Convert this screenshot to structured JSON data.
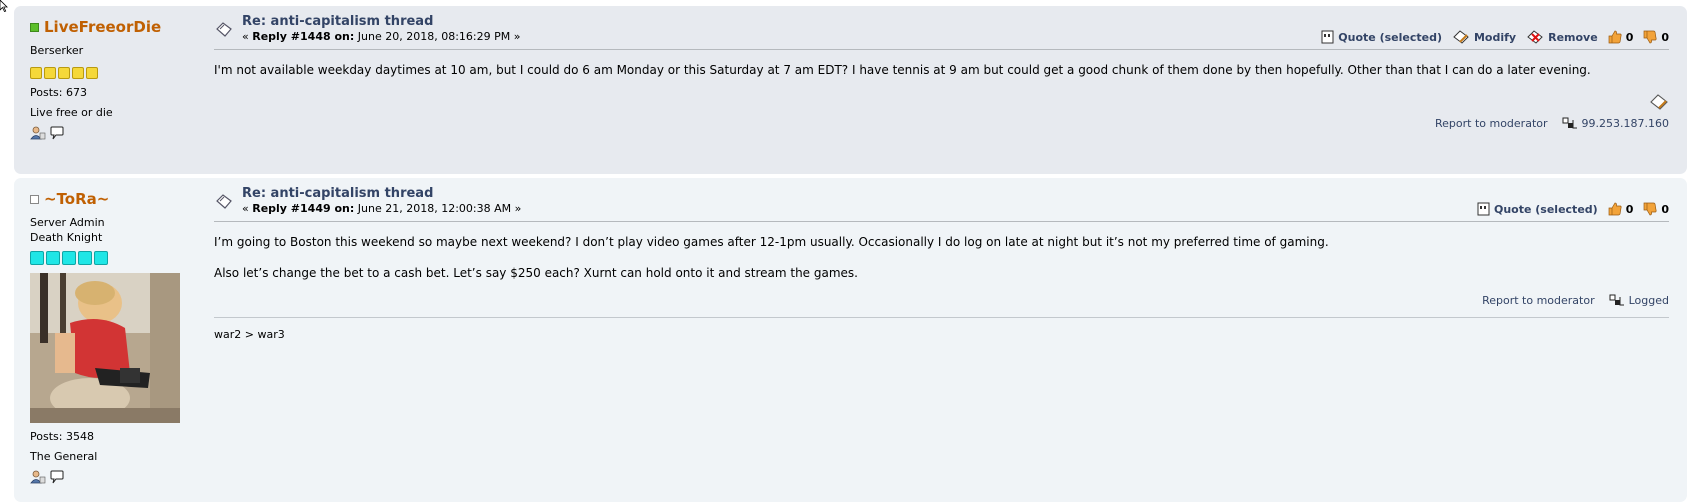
{
  "posts": [
    {
      "username": "LiveFreeorDie",
      "online": true,
      "titles": [
        "Berserker"
      ],
      "star_color": "#f5d83a",
      "star_count": 5,
      "posts_label": "Posts: 673",
      "custom_title": "Live free or die",
      "subject": "Re: anti-capitalism thread",
      "reply_label": "Reply #1448 on:",
      "date": "June 20, 2018, 08:16:29 PM",
      "buttons": {
        "quote": "Quote (selected)",
        "modify": "Modify",
        "remove": "Remove",
        "likes": "0",
        "dislikes": "0"
      },
      "body": [
        "I'm not available weekday daytimes at 10 am, but I could do 6 am Monday or this Saturday at 7 am EDT? I have tennis at 9 am but could get a good chunk of them done by then hopefully. Other than that I can do a later evening."
      ],
      "report": "Report to moderator",
      "ip": "99.253.187.160"
    },
    {
      "username": "~ToRa~",
      "online": false,
      "titles": [
        "Server Admin",
        "Death Knight"
      ],
      "star_color": "#1fe6e6",
      "star_count": 5,
      "posts_label": "Posts: 3548",
      "custom_title": "The General",
      "subject": "Re: anti-capitalism thread",
      "reply_label": "Reply #1449 on:",
      "date": "June 21, 2018, 12:00:38 AM",
      "buttons": {
        "quote": "Quote (selected)",
        "likes": "0",
        "dislikes": "0"
      },
      "body": [
        "I’m going to Boston this weekend so maybe next weekend? I don’t play video games after 12-1pm usually. Occasionally I do log on late at night but it’s not my preferred time of gaming.",
        "Also let’s change the bet to a cash bet. Let’s say $250 each? Xurnt can hold onto it and stream the games."
      ],
      "report": "Report to moderator",
      "ip": "Logged",
      "signature": "war2 > war3"
    }
  ],
  "labels": {
    "reply_prefix": "«",
    "reply_suffix": "»"
  }
}
